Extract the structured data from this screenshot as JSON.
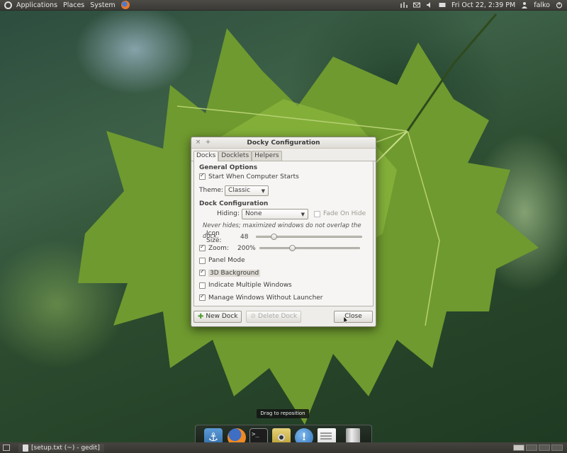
{
  "top_panel": {
    "menus": [
      "Applications",
      "Places",
      "System"
    ],
    "datetime": "Fri Oct 22,  2:39 PM",
    "user": "falko"
  },
  "dialog": {
    "title": "Docky Configuration",
    "tabs": [
      "Docks",
      "Docklets",
      "Helpers"
    ],
    "general": {
      "header": "General Options",
      "start_label": "Start When Computer Starts",
      "start_checked": true,
      "theme_label": "Theme:",
      "theme_value": "Classic"
    },
    "dock": {
      "header": "Dock Configuration",
      "hiding_label": "Hiding:",
      "hiding_value": "None",
      "fade_label": "Fade On Hide",
      "note": "Never hides; maximized windows do not overlap the dock.",
      "icon_size_label": "Icon Size:",
      "icon_size_value": "48",
      "icon_size_fraction": 0.17,
      "zoom_label": "Zoom:",
      "zoom_value": "200%",
      "zoom_fraction": 0.33,
      "options": [
        {
          "label": "Panel Mode",
          "checked": false
        },
        {
          "label": "3D Background",
          "checked": true
        },
        {
          "label": "Indicate Multiple Windows",
          "checked": false
        },
        {
          "label": "Manage Windows Without Launcher",
          "checked": true
        }
      ]
    },
    "buttons": {
      "new_dock": "New Dock",
      "delete_dock": "Delete Dock",
      "close": "Close"
    }
  },
  "dock_tooltip": "Drag to reposition",
  "taskbar": {
    "window_title": "[setup.txt (~) - gedit]"
  }
}
